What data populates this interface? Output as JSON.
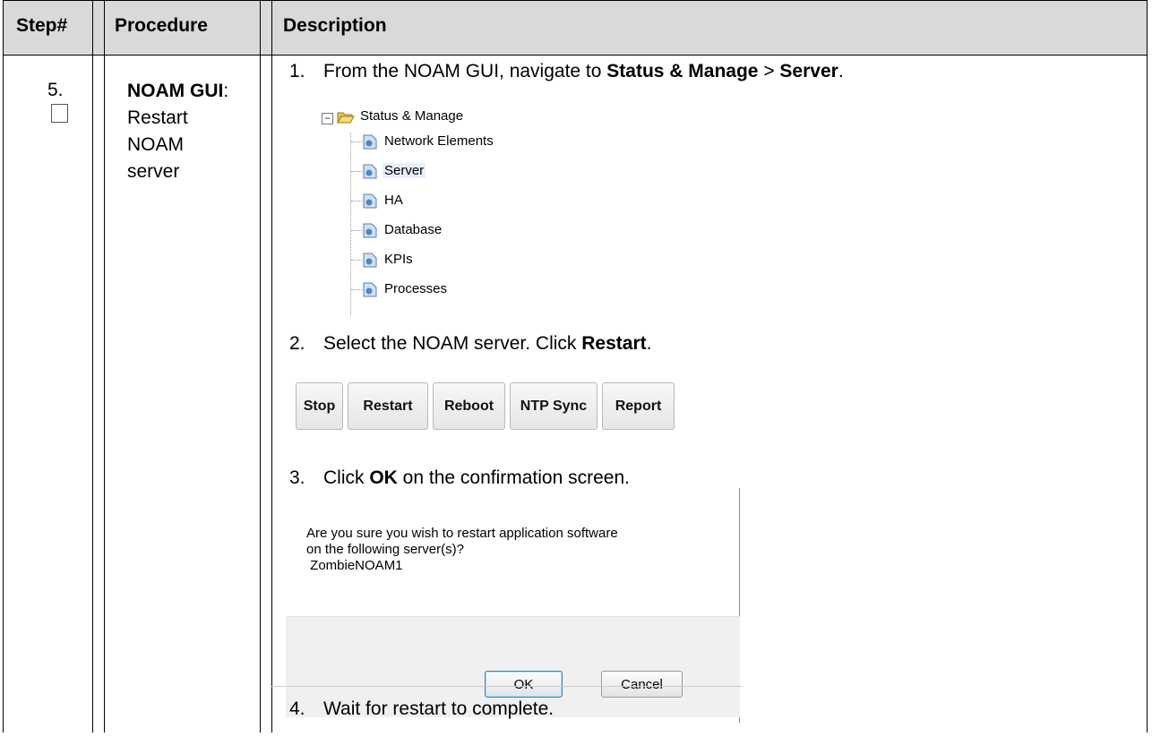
{
  "header": {
    "step": "Step#",
    "procedure": "Procedure",
    "description": "Description"
  },
  "row": {
    "step_number": "5.",
    "procedure_bold": "NOAM GUI",
    "procedure_colon": ":",
    "procedure_lines": [
      "Restart",
      "NOAM",
      "server"
    ]
  },
  "steps": [
    {
      "num": "1.",
      "pre": "From the NOAM GUI, navigate to ",
      "b1": "Status & Manage",
      "mid": " > ",
      "b2": "Server",
      "post": "."
    },
    {
      "num": "2.",
      "pre": "Select the NOAM server.  Click ",
      "b1": "Restart",
      "post": "."
    },
    {
      "num": "3.",
      "pre": "Click ",
      "b1": "OK",
      "post": " on the confirmation screen."
    },
    {
      "num": "4.",
      "pre": "Wait for restart to complete."
    }
  ],
  "tree": {
    "expander": "−",
    "root": "Status & Manage",
    "items": [
      "Network Elements",
      "Server",
      "HA",
      "Database",
      "KPIs",
      "Processes"
    ],
    "selected": "Server"
  },
  "buttons": [
    "Stop",
    "Restart",
    "Reboot",
    "NTP Sync",
    "Report"
  ],
  "dialog": {
    "lines": [
      "Are you sure you wish to restart application software",
      "on the following server(s)?",
      " ZombieNOAM1"
    ],
    "ok": "OK",
    "cancel": "Cancel"
  }
}
